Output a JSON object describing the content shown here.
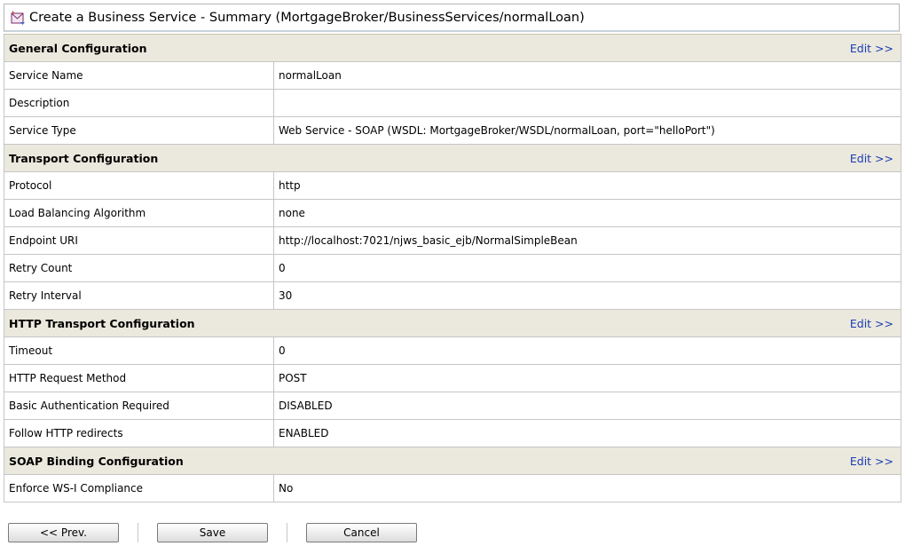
{
  "page": {
    "title": "Create a Business Service - Summary (MortgageBroker/BusinessServices/normalLoan)",
    "title_icon": "business-service-icon"
  },
  "sections": [
    {
      "heading": "General Configuration",
      "edit": "Edit >>",
      "rows": [
        {
          "label": "Service Name",
          "value": "normalLoan"
        },
        {
          "label": "Description",
          "value": ""
        },
        {
          "label": "Service Type",
          "value": "Web Service - SOAP (WSDL: MortgageBroker/WSDL/normalLoan, port=\"helloPort\")"
        }
      ]
    },
    {
      "heading": "Transport Configuration",
      "edit": "Edit >>",
      "rows": [
        {
          "label": "Protocol",
          "value": "http"
        },
        {
          "label": "Load Balancing Algorithm",
          "value": "none"
        },
        {
          "label": "Endpoint URI",
          "value": "http://localhost:7021/njws_basic_ejb/NormalSimpleBean"
        },
        {
          "label": "Retry Count",
          "value": "0"
        },
        {
          "label": "Retry Interval",
          "value": "30"
        }
      ]
    },
    {
      "heading": "HTTP Transport Configuration",
      "edit": "Edit >>",
      "rows": [
        {
          "label": "Timeout",
          "value": "0"
        },
        {
          "label": "HTTP Request Method",
          "value": "POST"
        },
        {
          "label": "Basic Authentication Required",
          "value": "DISABLED"
        },
        {
          "label": "Follow HTTP redirects",
          "value": "ENABLED"
        }
      ]
    },
    {
      "heading": "SOAP Binding Configuration",
      "edit": "Edit >>",
      "rows": [
        {
          "label": "Enforce WS-I Compliance",
          "value": "No"
        }
      ]
    }
  ],
  "footer": {
    "prev_label": "<< Prev.",
    "save_label": "Save",
    "cancel_label": "Cancel"
  },
  "colors": {
    "section_bg": "#ebe8dd",
    "edit_link": "#1a3cb4",
    "border": "#c6c6c6"
  }
}
